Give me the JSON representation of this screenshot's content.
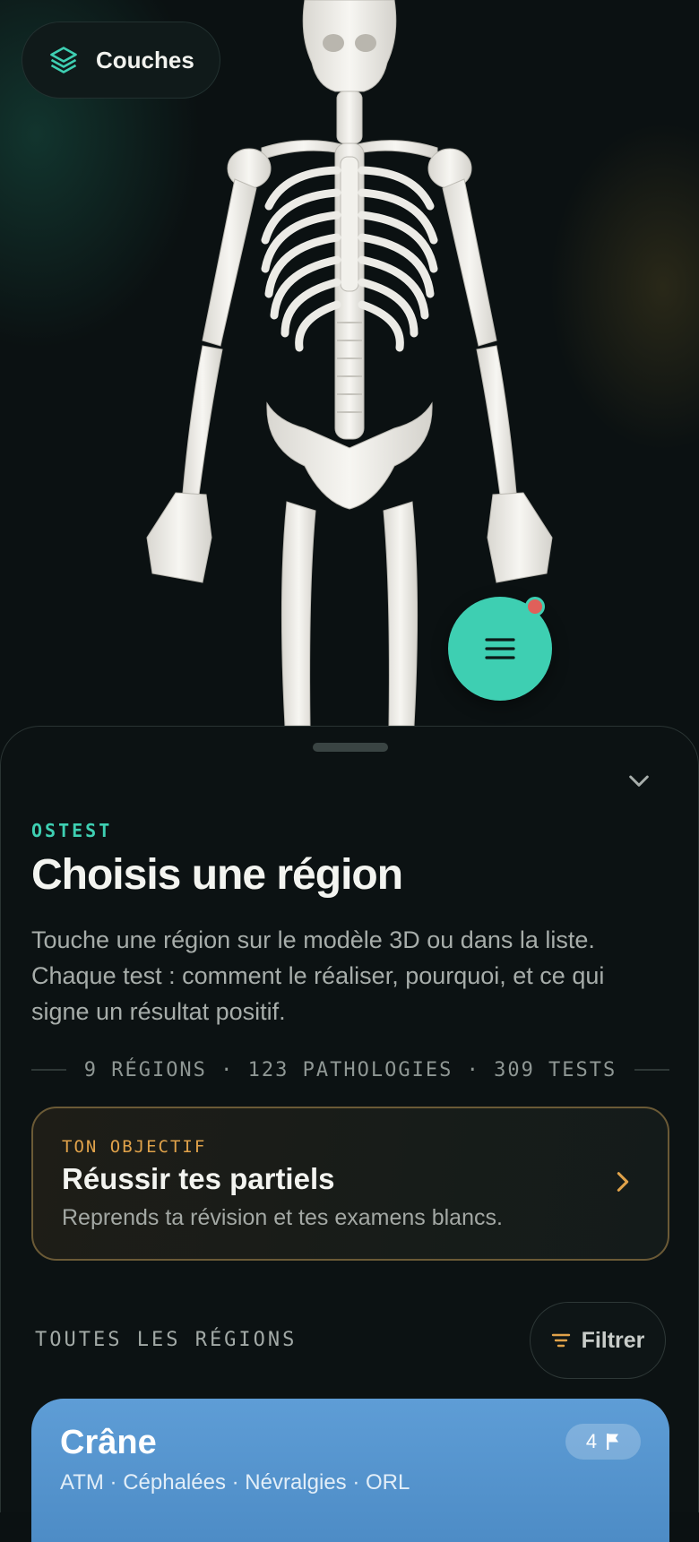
{
  "viewer": {
    "layers_button": {
      "label": "Couches",
      "icon": "layers-icon"
    },
    "menu_button": {
      "icon": "menu-icon",
      "has_notification": true
    }
  },
  "sheet": {
    "eyebrow": "OSTEST",
    "title": "Choisis une région",
    "description": "Touche une région sur le modèle 3D ou dans la liste. Chaque test : comment le réaliser, pourquoi, et ce qui signe un résultat positif.",
    "stats": "9 RÉGIONS · 123 PATHOLOGIES · 309 TESTS",
    "goal": {
      "kicker": "TON OBJECTIF",
      "title": "Réussir tes partiels",
      "subtitle": "Reprends ta révision et tes examens blancs."
    },
    "section_label": "TOUTES LES RÉGIONS",
    "filter_label": "Filtrer",
    "regions": [
      {
        "name": "Crâne",
        "tags": "ATM · Céphalées · Névralgies · ORL",
        "count": "4",
        "color": "#5e9dd6"
      }
    ]
  },
  "colors": {
    "accent": "#3ecfb2",
    "goal_accent": "#e0a24a",
    "notification": "#e0605a"
  }
}
